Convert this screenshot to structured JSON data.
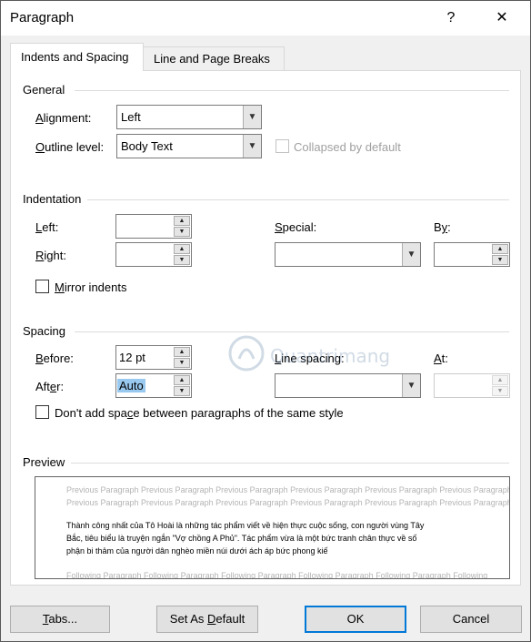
{
  "window": {
    "title": "Paragraph",
    "help": "?",
    "close": "✕"
  },
  "tabs": [
    "Indents and Spacing",
    "Line and Page Breaks"
  ],
  "general": {
    "heading": "General",
    "alignment_label": "Alignment:",
    "alignment_value": "Left",
    "outline_label": "Outline level:",
    "outline_value": "Body Text",
    "collapsed_label": "Collapsed by default"
  },
  "indentation": {
    "heading": "Indentation",
    "left_label": "Left:",
    "left_value": "",
    "right_label": "Right:",
    "right_value": "",
    "special_label": "Special:",
    "special_value": "",
    "by_label": "By:",
    "by_value": "",
    "mirror_label": "Mirror indents"
  },
  "spacing": {
    "heading": "Spacing",
    "before_label": "Before:",
    "before_value": "12 pt",
    "after_label": "After:",
    "after_value": "Auto",
    "line_spacing_label": "Line spacing:",
    "line_spacing_value": "",
    "at_label": "At:",
    "at_value": "",
    "dont_add_label": "Don't add space between paragraphs of the same style"
  },
  "preview": {
    "heading": "Preview",
    "prev_1": "Previous Paragraph Previous Paragraph Previous Paragraph Previous Paragraph Previous Paragraph Previous Paragraph",
    "prev_2": "Previous Paragraph Previous Paragraph Previous Paragraph Previous Paragraph Previous Paragraph Previous Paragraph",
    "body_1": "Thành công nhất của Tô Hoài là những tác phẩm viết về hiện thực cuộc sống, con người vùng Tây",
    "body_2": "Bắc, tiêu biểu là truyện ngắn \"Vợ chồng A Phủ\". Tác phẩm vừa là một bức tranh chân thực về số",
    "body_3": "phận bi thảm của người dân nghèo miền núi dưới ách áp bức phong kiế",
    "follow_1": "Following Paragraph Following Paragraph Following Paragraph Following Paragraph Following Paragraph Following"
  },
  "buttons": {
    "tabs": "Tabs...",
    "set_default": "Set As Default",
    "ok": "OK",
    "cancel": "Cancel"
  },
  "watermark": "Quantrimang"
}
